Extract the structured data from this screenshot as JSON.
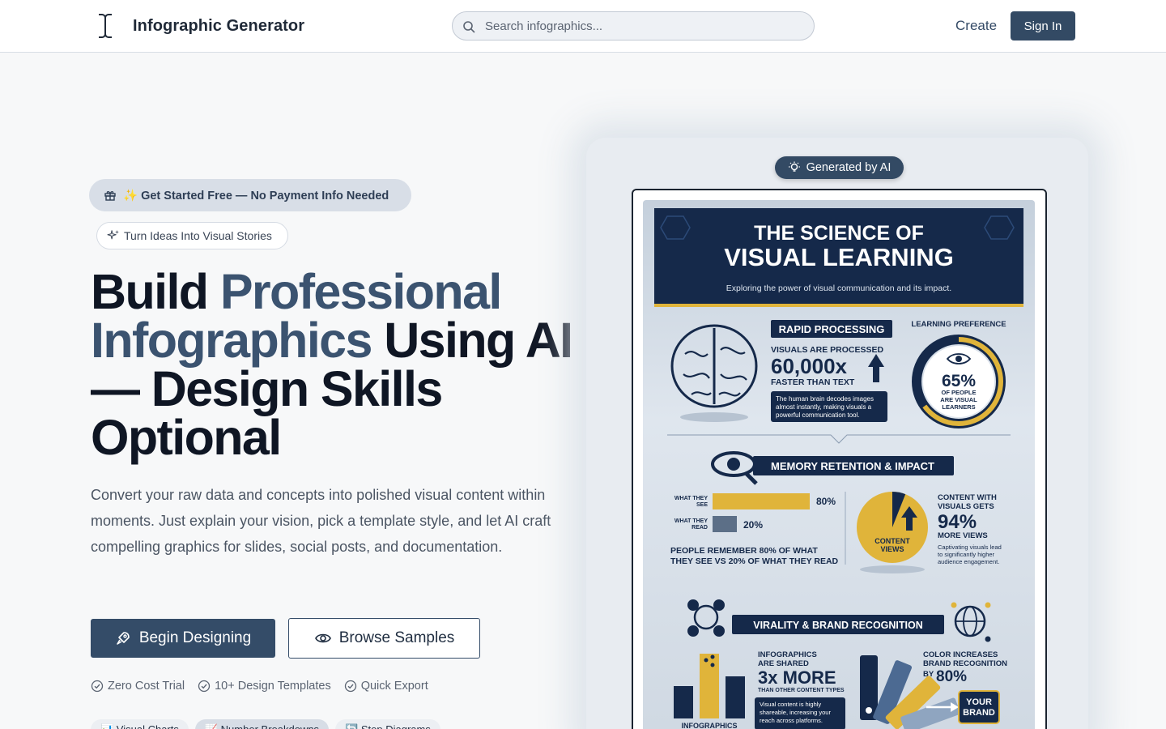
{
  "header": {
    "brand_name": "Infographic Generator",
    "search_placeholder": "Search infographics...",
    "create_label": "Create",
    "signin_label": "Sign In"
  },
  "hero": {
    "free_pill": "✨ Get Started Free — No Payment Info Needed",
    "ideas_pill": "Turn Ideas Into Visual Stories",
    "headline_part1": "Build ",
    "headline_accent": "Professional Infographics",
    "headline_part2": " Using AI — Design Skills Optional",
    "subtext": "Convert your raw data and concepts into polished visual content within moments. Just explain your vision, pick a template style, and let AI craft compelling graphics for slides, social posts, and documentation.",
    "primary_button": "Begin Designing",
    "secondary_button": "Browse Samples",
    "features": [
      "Zero Cost Trial",
      "10+ Design Templates",
      "Quick Export"
    ],
    "chips": [
      "📊 Visual Charts",
      "📈 Number Breakdowns",
      "🔄 Step Diagrams"
    ]
  },
  "preview": {
    "badge": "Generated by AI",
    "poster": {
      "title_line1": "THE SCIENCE OF",
      "title_line2": "VISUAL LEARNING",
      "subtitle": "Exploring the power of visual communication and its impact.",
      "rapid_heading": "RAPID PROCESSING",
      "rapid_line1": "VISUALS ARE PROCESSED",
      "rapid_stat": "60,000x",
      "rapid_line2": "FASTER THAN TEXT",
      "rapid_note1": "The human brain decodes images",
      "rapid_note2": "almost instantly, making visuals a",
      "rapid_note3": "powerful communication tool.",
      "pref_heading": "LEARNING PREFERENCE",
      "pref_stat": "65%",
      "pref_line1": "OF PEOPLE",
      "pref_line2": "ARE VISUAL",
      "pref_line3": "LEARNERS",
      "memory_heading": "MEMORY RETENTION & IMPACT",
      "see_label1": "WHAT THEY",
      "see_label2": "SEE",
      "see_value": "80%",
      "read_label1": "WHAT THEY",
      "read_label2": "READ",
      "read_value": "20%",
      "remember_line1": "PEOPLE REMEMBER 80% OF WHAT",
      "remember_line2": "THEY SEE VS 20% OF WHAT THEY READ",
      "pie_label1": "CONTENT",
      "pie_label2": "VIEWS",
      "views_line1": "CONTENT WITH",
      "views_line2": "VISUALS GETS",
      "views_stat": "94%",
      "views_line3": "MORE VIEWS",
      "views_note1": "Captivating visuals lead",
      "views_note2": "to significantly higher",
      "views_note3": "audience engagement.",
      "virality_heading": "VIRALITY & BRAND RECOGNITION",
      "shared_line1": "INFOGRAPHICS",
      "shared_line2": "ARE SHARED",
      "shared_stat": "3x MORE",
      "shared_line3": "THAN OTHER CONTENT TYPES",
      "shared_note1": "Visual content is highly",
      "shared_note2": "shareable, increasing your",
      "shared_note3": "reach across platforms.",
      "bar_label": "INFOGRAPHICS",
      "color_line1": "COLOR INCREASES",
      "color_line2": "BRAND RECOGNITION",
      "color_line3": "BY",
      "color_stat": "80%",
      "brand_line1": "YOUR",
      "brand_line2": "BRAND"
    }
  },
  "colors": {
    "primary": "#344c68",
    "accent_text": "#3b5370",
    "poster_navy": "#15294a",
    "poster_gold": "#e0b43a"
  }
}
